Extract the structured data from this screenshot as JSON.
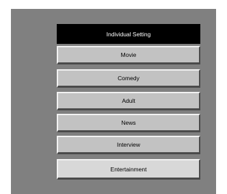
{
  "menu": {
    "title": "Individual  Setting",
    "items": [
      {
        "label": "Movie"
      },
      {
        "label": "Comedy"
      },
      {
        "label": "Adult"
      },
      {
        "label": "News"
      },
      {
        "label": "Interview"
      },
      {
        "label": "Entertainment"
      }
    ]
  },
  "colors": {
    "panel": "#808080",
    "header_bg": "#000000",
    "header_text": "#ffffff",
    "item_bg": "#c2c2c2"
  }
}
